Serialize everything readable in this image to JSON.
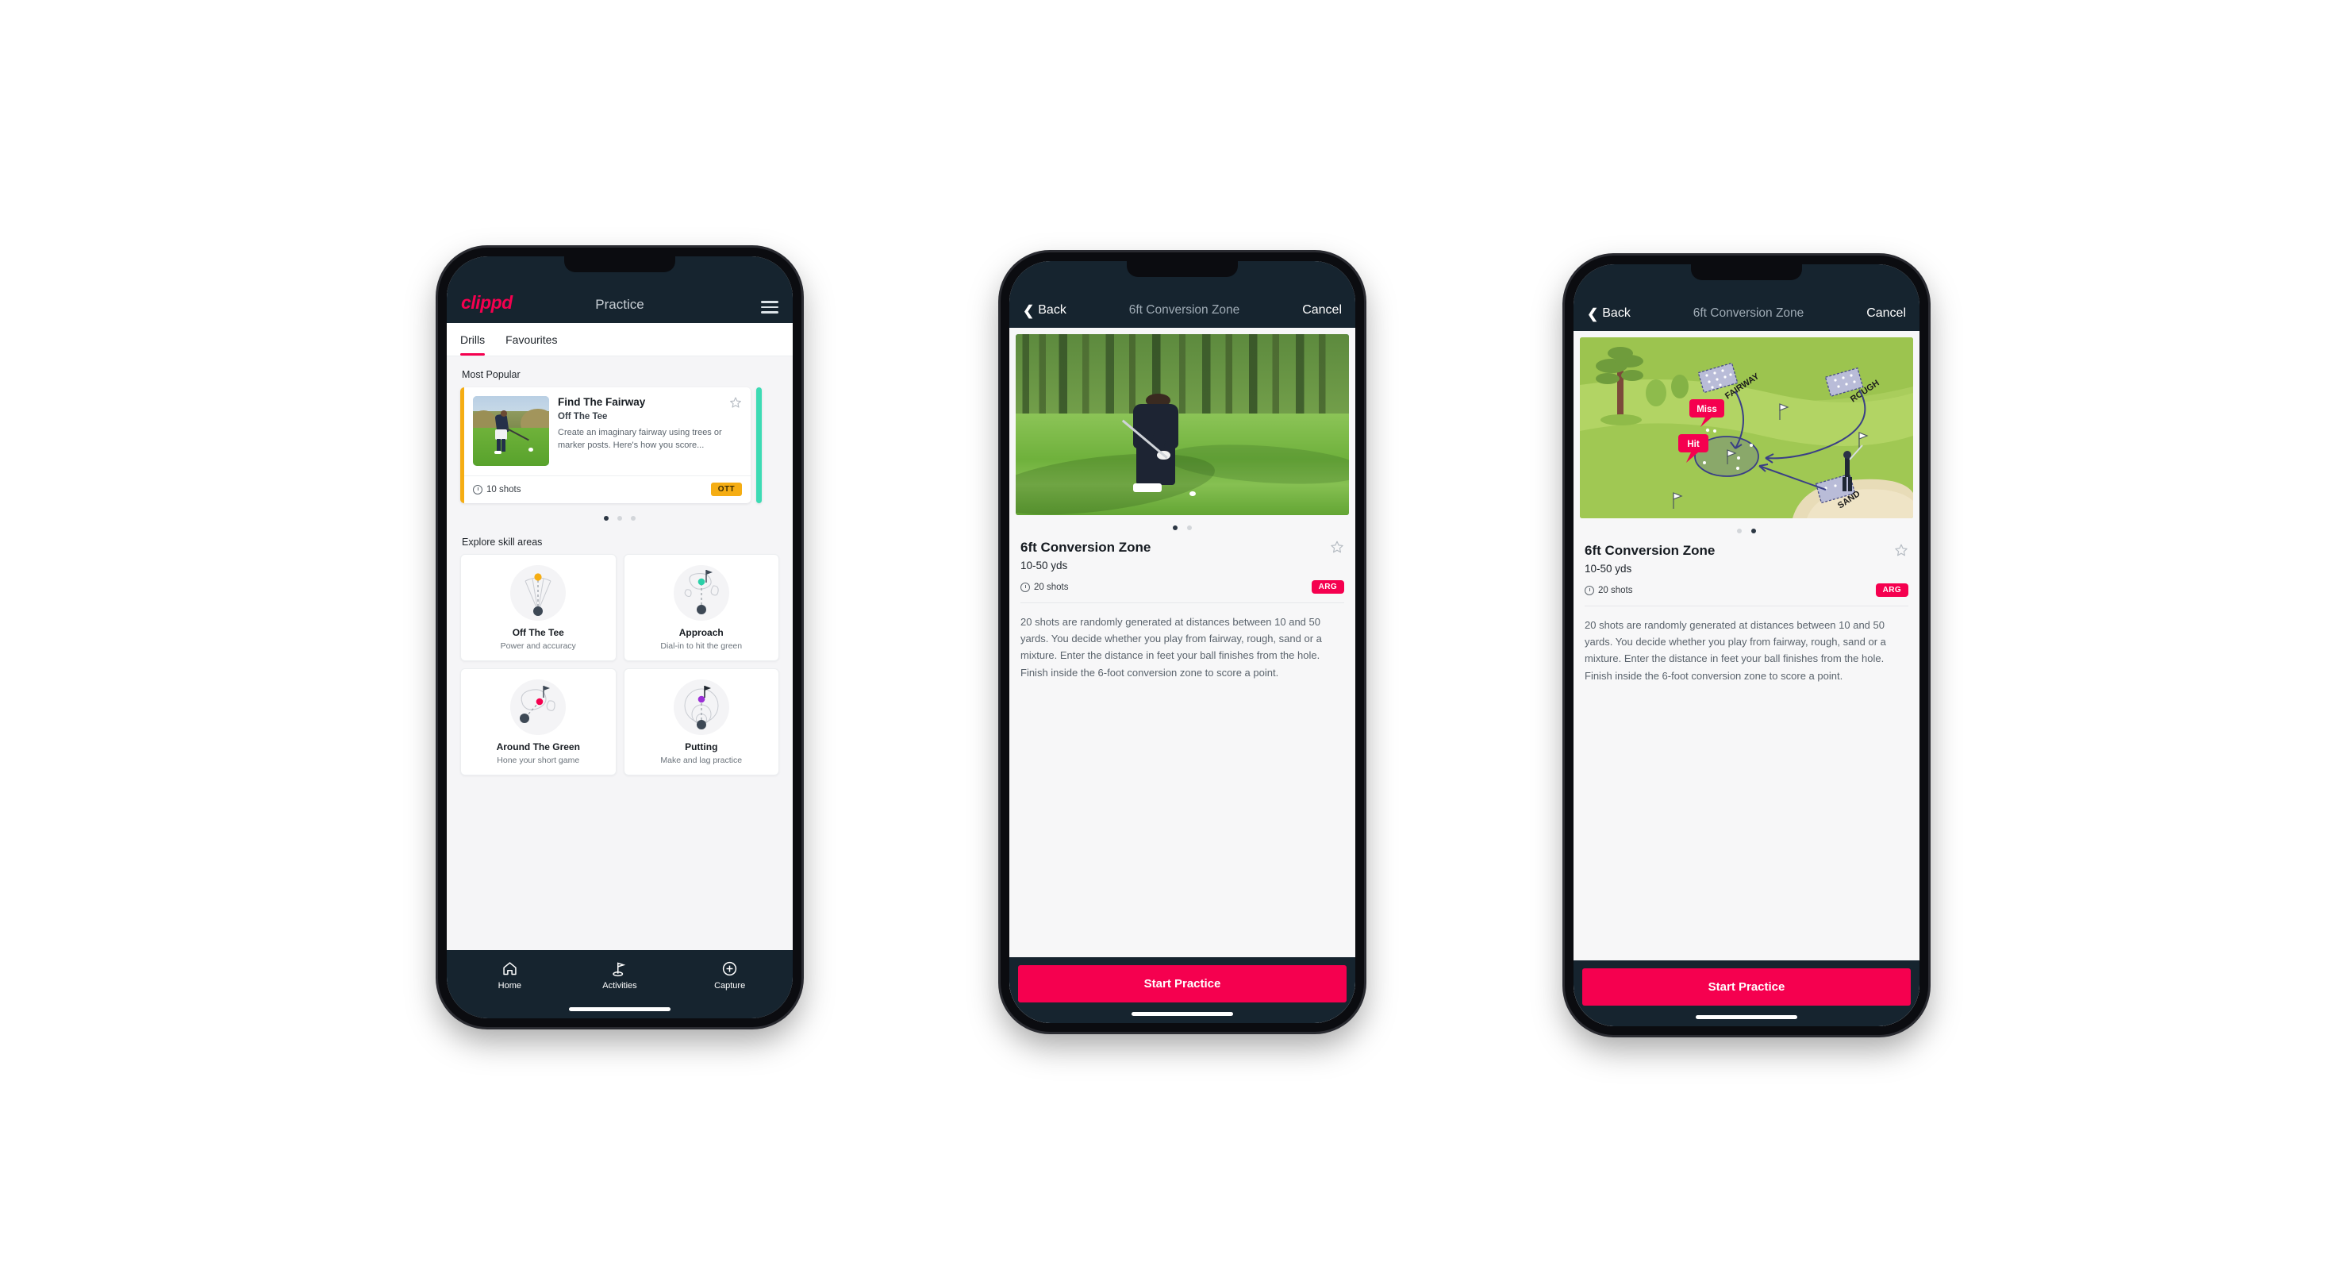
{
  "colors": {
    "navy": "#16242f",
    "pink": "#f5004f",
    "amber": "#f5ad13",
    "teal": "#3ddbb4",
    "page_bg": "#ffffff"
  },
  "phone1": {
    "header": {
      "brand": "clippd",
      "title": "Practice",
      "menu_icon": "hamburger-menu-icon"
    },
    "tabs": [
      {
        "label": "Drills",
        "active": true
      },
      {
        "label": "Favourites",
        "active": false
      }
    ],
    "most_popular": {
      "section_title": "Most Popular",
      "card": {
        "name": "Find The Fairway",
        "category": "Off The Tee",
        "description": "Create an imaginary fairway using trees or marker posts. Here's how you score...",
        "shots": "10 shots",
        "badge": "OTT",
        "favourite_icon": "star-outline-icon",
        "clock_icon": "clock-icon",
        "accent_color": "#f5ad13"
      },
      "dots": {
        "count": 3,
        "active_index": 0
      }
    },
    "skill_areas": {
      "section_title": "Explore skill areas",
      "items": [
        {
          "name": "Off The Tee",
          "desc": "Power and accuracy",
          "icon": "tee-fan-icon",
          "dot_color": "#f5ad13"
        },
        {
          "name": "Approach",
          "desc": "Dial-in to hit the green",
          "icon": "green-approach-icon",
          "dot_color": "#2ad0a8"
        },
        {
          "name": "Around The Green",
          "desc": "Hone your short game",
          "icon": "chip-around-green-icon",
          "dot_color": "#f5004f"
        },
        {
          "name": "Putting",
          "desc": "Make and lag practice",
          "icon": "putting-rings-icon",
          "dot_color": "#9b2fd6"
        }
      ]
    },
    "bottom_nav": [
      {
        "label": "Home",
        "icon": "home-icon",
        "active": false
      },
      {
        "label": "Activities",
        "icon": "golf-flag-icon",
        "active": true
      },
      {
        "label": "Capture",
        "icon": "plus-circle-icon",
        "active": false
      }
    ]
  },
  "phone2": {
    "header": {
      "back": "Back",
      "title": "6ft Conversion Zone",
      "cancel": "Cancel",
      "back_icon": "chevron-left-icon"
    },
    "media": {
      "type": "photo",
      "alt": "golfer chipping on fairway"
    },
    "dots": {
      "count": 2,
      "active_index": 0
    },
    "detail": {
      "title": "6ft Conversion Zone",
      "range": "10-50 yds",
      "shots": "20 shots",
      "badge": "ARG",
      "favourite_icon": "star-outline-icon",
      "clock_icon": "clock-icon",
      "description": "20 shots are randomly generated at distances between 10 and 50 yards. You decide whether you play from fairway, rough, sand or a mixture. Enter the distance in feet your ball finishes from the hole. Finish inside the 6-foot conversion zone to score a point."
    },
    "cta": "Start Practice"
  },
  "phone3": {
    "header": {
      "back": "Back",
      "title": "6ft Conversion Zone",
      "cancel": "Cancel",
      "back_icon": "chevron-left-icon"
    },
    "media": {
      "type": "illustration",
      "labels": {
        "fairway": "FAIRWAY",
        "rough": "ROUGH",
        "sand": "SAND",
        "miss": "Miss",
        "hit": "Hit"
      }
    },
    "dots": {
      "count": 2,
      "active_index": 1
    },
    "detail": {
      "title": "6ft Conversion Zone",
      "range": "10-50 yds",
      "shots": "20 shots",
      "badge": "ARG",
      "favourite_icon": "star-outline-icon",
      "clock_icon": "clock-icon",
      "description": "20 shots are randomly generated at distances between 10 and 50 yards. You decide whether you play from fairway, rough, sand or a mixture. Enter the distance in feet your ball finishes from the hole. Finish inside the 6-foot conversion zone to score a point."
    },
    "cta": "Start Practice"
  }
}
